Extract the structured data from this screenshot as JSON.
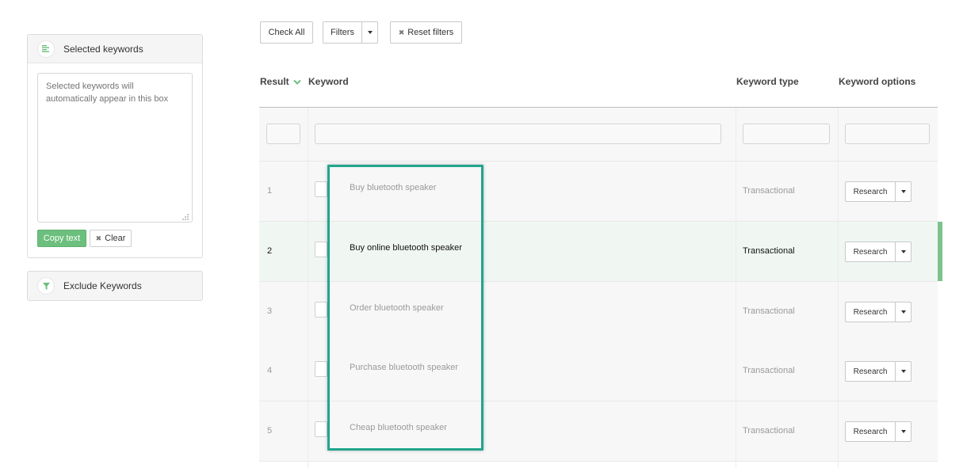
{
  "sidebar": {
    "selected_panel": {
      "title": "Selected keywords",
      "icon": "list-align-icon",
      "placeholder": "Selected keywords will automatically appear in this box",
      "copy_label": "Copy text",
      "clear_label": "Clear"
    },
    "exclude_panel": {
      "title": "Exclude Keywords",
      "icon": "filter-icon"
    }
  },
  "toolbar": {
    "check_all": "Check All",
    "filters": "Filters",
    "reset_filters": "Reset filters"
  },
  "table": {
    "headers": {
      "result": "Result",
      "keyword": "Keyword",
      "keyword_type": "Keyword type",
      "keyword_options": "Keyword options"
    },
    "rows": [
      {
        "num": "1",
        "keyword": "Buy bluetooth speaker",
        "type": "Transactional",
        "action": "Research"
      },
      {
        "num": "2",
        "keyword": "Buy online bluetooth speaker",
        "type": "Transactional",
        "action": "Research"
      },
      {
        "num": "3",
        "keyword": "Order bluetooth speaker",
        "type": "Transactional",
        "action": "Research"
      },
      {
        "num": "4",
        "keyword": "Purchase bluetooth speaker",
        "type": "Transactional",
        "action": "Research"
      },
      {
        "num": "5",
        "keyword": "Cheap bluetooth speaker",
        "type": "Transactional",
        "action": "Research"
      }
    ]
  },
  "colors": {
    "accent_green": "#6cbf7d",
    "highlight_teal": "#22a58d"
  }
}
